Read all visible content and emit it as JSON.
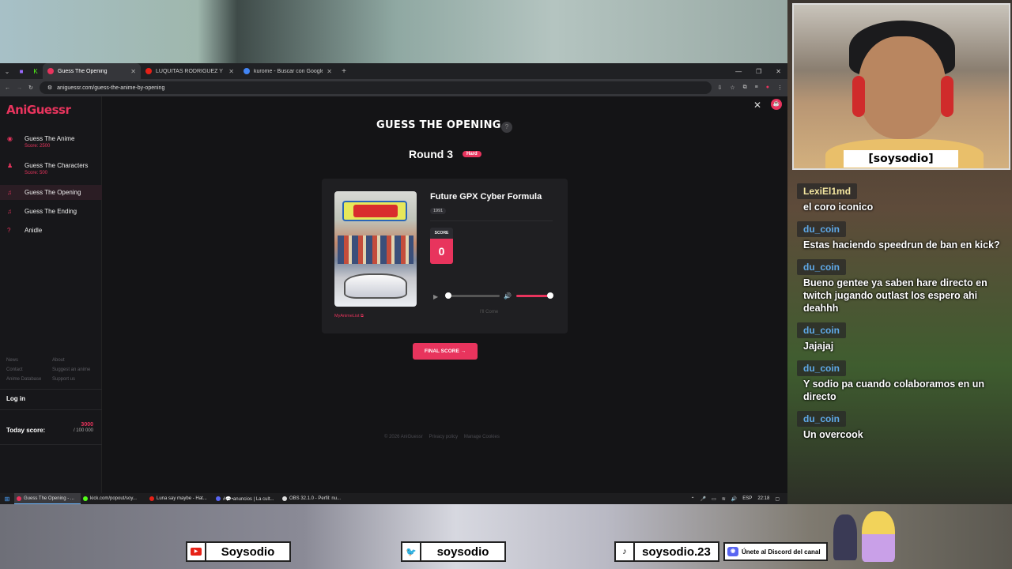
{
  "browser": {
    "tabs": [
      {
        "title": "Guess The Opening",
        "active": true,
        "color": "#e8345d"
      },
      {
        "title": "LUQUITAS RODRIGUEZ Y LA FI",
        "active": false,
        "color": "#e62117"
      },
      {
        "title": "kurome - Buscar con Google",
        "active": false,
        "color": "#4285f4"
      }
    ],
    "url": "aniguessr.com/guess-the-anime-by-opening"
  },
  "sidebar": {
    "logo": "AniGuessr",
    "items": [
      {
        "label": "Guess The Anime",
        "sub": "Score: 2500",
        "icon": "camera-icon"
      },
      {
        "label": "Guess The Characters",
        "sub": "Score: 500",
        "icon": "user-icon"
      },
      {
        "label": "Guess The Opening",
        "sub": "",
        "icon": "music-list-icon",
        "active": true
      },
      {
        "label": "Guess The Ending",
        "sub": "",
        "icon": "music-list-icon"
      },
      {
        "label": "Anidle",
        "sub": "",
        "icon": "question-icon"
      }
    ],
    "footer_links": [
      "News",
      "About",
      "Contact",
      "Suggest an anime",
      "Anime Database",
      "Support us"
    ],
    "login": "Log in",
    "today_label": "Today score:",
    "today_value": "3000",
    "today_max": "/ 100 000"
  },
  "main": {
    "title": "GUESS THE OPENING",
    "help": "?",
    "round": "Round 3",
    "difficulty": "Hard",
    "anime_title": "Future GPX Cyber Formula",
    "year": "1991",
    "score_label": "SCORE",
    "score_value": "0",
    "song": "I'll Come",
    "mal_link": "MyAnimeList ⧉",
    "final_button": "FINAL SCORE",
    "copyright": "© 2026 AniGuessr",
    "privacy": "Privacy policy",
    "cookies": "Manage Cookies",
    "player_progress": 0,
    "volume": 1
  },
  "taskbar": {
    "items": [
      {
        "title": "Guess The Opening - ...",
        "color": "#e8345d",
        "active": true
      },
      {
        "title": "kick.com/popout/soy...",
        "color": "#53fc18"
      },
      {
        "title": "Luna say maybe - Hat...",
        "color": "#e62117"
      },
      {
        "title": "#💬•anuncios | La cult...",
        "color": "#5865f2"
      },
      {
        "title": "OBS 32.1.0 - Perfil: nu...",
        "color": "#dddddd"
      }
    ],
    "lang": "ESP",
    "time": "22:18"
  },
  "stream": {
    "cam_name": "[soysodio]",
    "chat": [
      {
        "user": "LexiEl1md",
        "text": "el coro iconico",
        "style": "y"
      },
      {
        "user": "du_coin",
        "text": "Estas haciendo speedrun de ban en kick?",
        "style": "b"
      },
      {
        "user": "du_coin",
        "text": "Bueno gentee ya saben hare directo en twitch jugando outlast los espero ahi deahhh",
        "style": "b"
      },
      {
        "user": "du_coin",
        "text": "Jajajaj",
        "style": "b"
      },
      {
        "user": "du_coin",
        "text": "Y sodio pa cuando colaboramos en un directo",
        "style": "b"
      },
      {
        "user": "du_coin",
        "text": "Un overcook",
        "style": "b"
      }
    ],
    "socials": {
      "youtube": "Soysodio",
      "twitter": "soysodio",
      "tiktok": "soysodio.23",
      "discord": "Únete al Discord del canal"
    }
  }
}
